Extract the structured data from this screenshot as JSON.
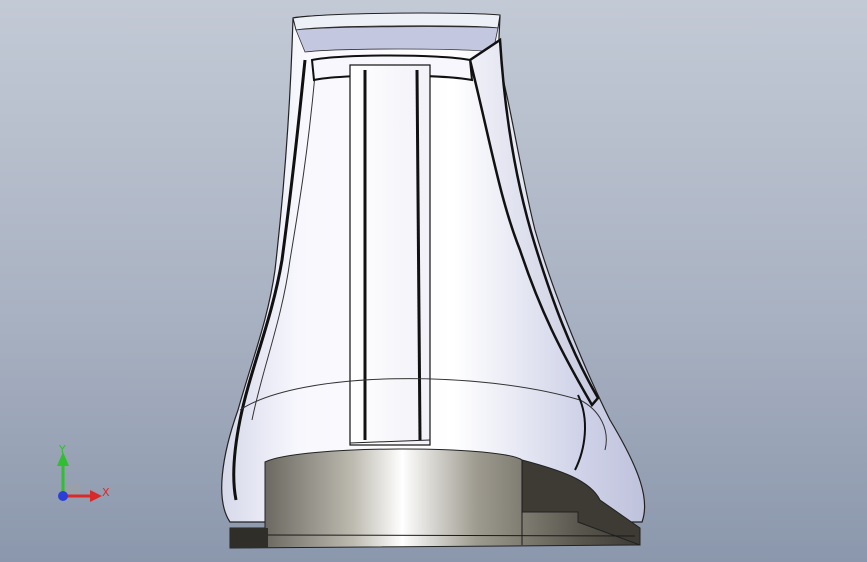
{
  "viewport": {
    "background_top": "#b8c0cd",
    "background_bottom": "#8896ab"
  },
  "triad": {
    "y_label": "Y",
    "x_label": "X",
    "y_color": "#2fbf2f",
    "x_color": "#d82a2a",
    "z_color": "#2a3fd8",
    "icon": "coordinate-triad-icon"
  },
  "model": {
    "name": "boot-rear-view",
    "body_color": "#f4f4fb",
    "shade_color": "#c9cde4",
    "heel_color": "#5e5b52",
    "outline_color": "#111111"
  }
}
